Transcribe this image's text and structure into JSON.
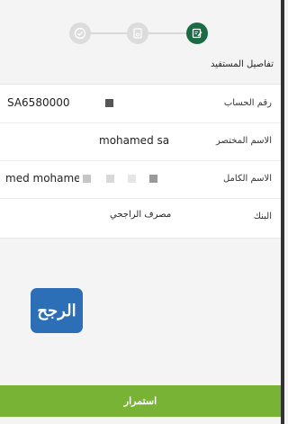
{
  "stepper": {
    "steps": [
      {
        "icon": "check-circle-icon",
        "state": "done"
      },
      {
        "icon": "document-icon",
        "state": "done"
      },
      {
        "icon": "edit-note-icon",
        "state": "active"
      }
    ],
    "active_color": "#1b6b45"
  },
  "section_title": "تفاصيل المستفيد",
  "beneficiary": {
    "account_number_label": "رقم الحساب",
    "account_number_value": "SA6580000",
    "short_name_label": "الاسم المختصر",
    "short_name_value": "mohamed sa",
    "full_name_label": "الاسم الكامل",
    "full_name_value": "med mohame",
    "bank_label": "البنك",
    "bank_value": "مصرف الراجحي"
  },
  "logo": {
    "text": "الرجح"
  },
  "continue_label": "استمرار",
  "colors": {
    "accent_green": "#78b335",
    "brand_blue": "#2d6fb6"
  }
}
